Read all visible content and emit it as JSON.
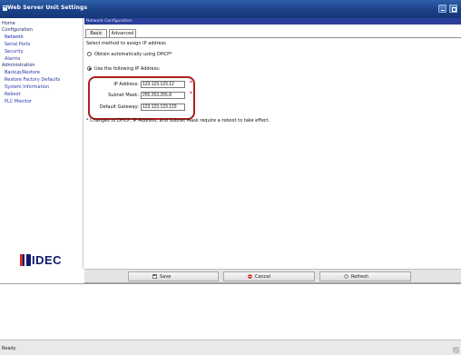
{
  "window": {
    "title": "Web Server Unit Settings"
  },
  "sidebar": {
    "items": [
      {
        "label": "Home",
        "level": 0
      },
      {
        "label": "Configuration",
        "level": 0
      },
      {
        "label": "Network",
        "level": 1
      },
      {
        "label": "Serial Ports",
        "level": 1
      },
      {
        "label": "Security",
        "level": 1
      },
      {
        "label": "Alarms",
        "level": 1
      },
      {
        "label": "Administration",
        "level": 0
      },
      {
        "label": "Backup/Restore",
        "level": 1
      },
      {
        "label": "Restore Factory Defaults",
        "level": 1
      },
      {
        "label": "System Information",
        "level": 1
      },
      {
        "label": "Reboot",
        "level": 1
      },
      {
        "label": "PLC Monitor",
        "level": 1
      }
    ],
    "logo_text": "IDEC"
  },
  "content": {
    "section_title": "Network Configuration",
    "tabs": [
      {
        "label": "Basic",
        "active": false
      },
      {
        "label": "Advanced",
        "active": true
      }
    ],
    "instruction": "Select method to assign IP address",
    "option_dhcp": "Obtain automatically using DHCP*",
    "option_static": "Use the following IP Address:",
    "selected_option": "static",
    "ip_label": "IP Address:",
    "ip_value": "123.123.123.12",
    "mask_label": "Subnet Mask:",
    "mask_value": "255.253.255.8",
    "gateway_label": "Default Gateway:",
    "gateway_value": "123.123.123.123",
    "required_mark": "*",
    "note": "* Changes to DHCP, IP Address, and Subnet Mask require a reboot to take effect."
  },
  "buttons": {
    "save": "Save",
    "cancel": "Cancel",
    "refresh": "Refresh"
  },
  "status": {
    "text": "Ready"
  },
  "colors": {
    "titlebar": "#1a3f86",
    "section_header": "#2a3f9a",
    "highlight_border": "#b0201c",
    "logo": "#0d1a6e"
  }
}
